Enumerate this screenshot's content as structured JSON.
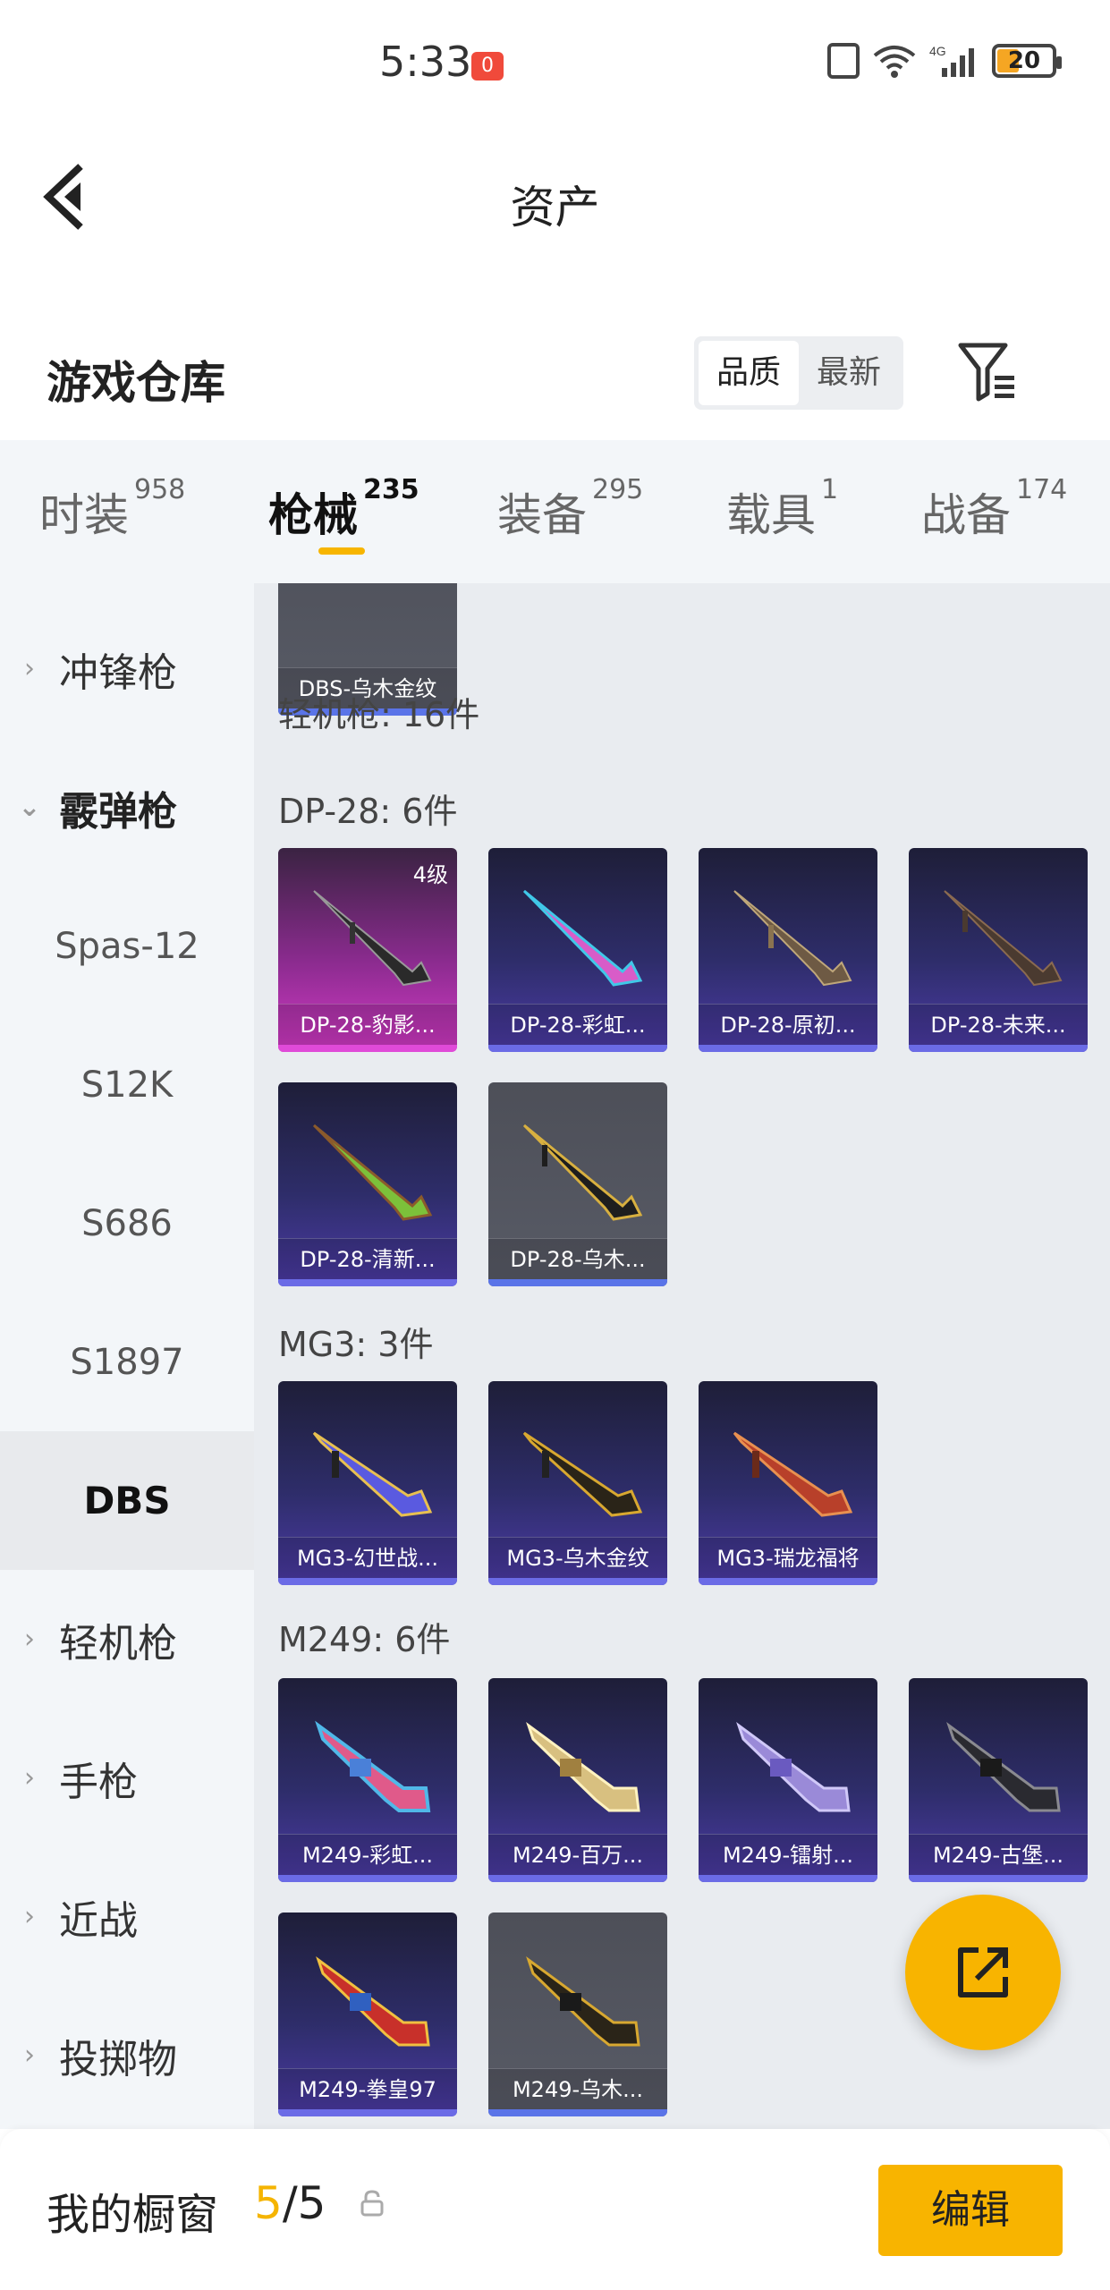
{
  "status_bar": {
    "time": "5:33",
    "notification_badge": "0",
    "battery": "20"
  },
  "nav": {
    "title": "资产"
  },
  "warehouse": {
    "title": "游戏仓库",
    "sort_options": [
      "品质",
      "最新"
    ],
    "sort_active": "品质"
  },
  "tabs": [
    {
      "label": "时装",
      "count": "958"
    },
    {
      "label": "枪械",
      "count": "235",
      "active": true
    },
    {
      "label": "装备",
      "count": "295"
    },
    {
      "label": "载具",
      "count": "1"
    },
    {
      "label": "战备",
      "count": "174"
    }
  ],
  "sidebar": {
    "items": [
      {
        "label": "冲锋枪",
        "arrow": "›"
      },
      {
        "label": "霰弹枪",
        "arrow": "⌄"
      },
      {
        "label": "Spas-12"
      },
      {
        "label": "S12K"
      },
      {
        "label": "S686"
      },
      {
        "label": "S1897"
      },
      {
        "label": "DBS"
      },
      {
        "label": "轻机枪",
        "arrow": "›"
      },
      {
        "label": "手枪",
        "arrow": "›"
      },
      {
        "label": "近战",
        "arrow": "›"
      },
      {
        "label": "投掷物",
        "arrow": "›"
      }
    ]
  },
  "content": {
    "top_item": "DBS-乌木金纹",
    "category_total": "轻机枪: 16件",
    "groups": [
      {
        "label": "DP-28: 6件",
        "items": [
          {
            "name": "DP-28-豹影...",
            "level": "4级",
            "style": "pink"
          },
          {
            "name": "DP-28-彩虹...",
            "style": "purple"
          },
          {
            "name": "DP-28-原初...",
            "style": "purple"
          },
          {
            "name": "DP-28-未来...",
            "style": "purple"
          },
          {
            "name": "DP-28-清新...",
            "style": "purple"
          },
          {
            "name": "DP-28-乌木...",
            "style": "grey"
          }
        ]
      },
      {
        "label": "MG3: 3件",
        "items": [
          {
            "name": "MG3-幻世战...",
            "style": "purple"
          },
          {
            "name": "MG3-乌木金纹",
            "style": "purple"
          },
          {
            "name": "MG3-瑞龙福将",
            "style": "purple"
          }
        ]
      },
      {
        "label": "M249: 6件",
        "items": [
          {
            "name": "M249-彩虹...",
            "style": "purple"
          },
          {
            "name": "M249-百万...",
            "style": "purple"
          },
          {
            "name": "M249-镭射...",
            "style": "purple"
          },
          {
            "name": "M249-古堡...",
            "style": "purple"
          },
          {
            "name": "M249-拳皇97",
            "style": "purple"
          },
          {
            "name": "M249-乌木...",
            "style": "grey"
          }
        ]
      }
    ]
  },
  "bottom": {
    "showcase_label": "我的橱窗",
    "showcase_used": "5",
    "showcase_total": "/5",
    "edit_label": "编辑"
  }
}
